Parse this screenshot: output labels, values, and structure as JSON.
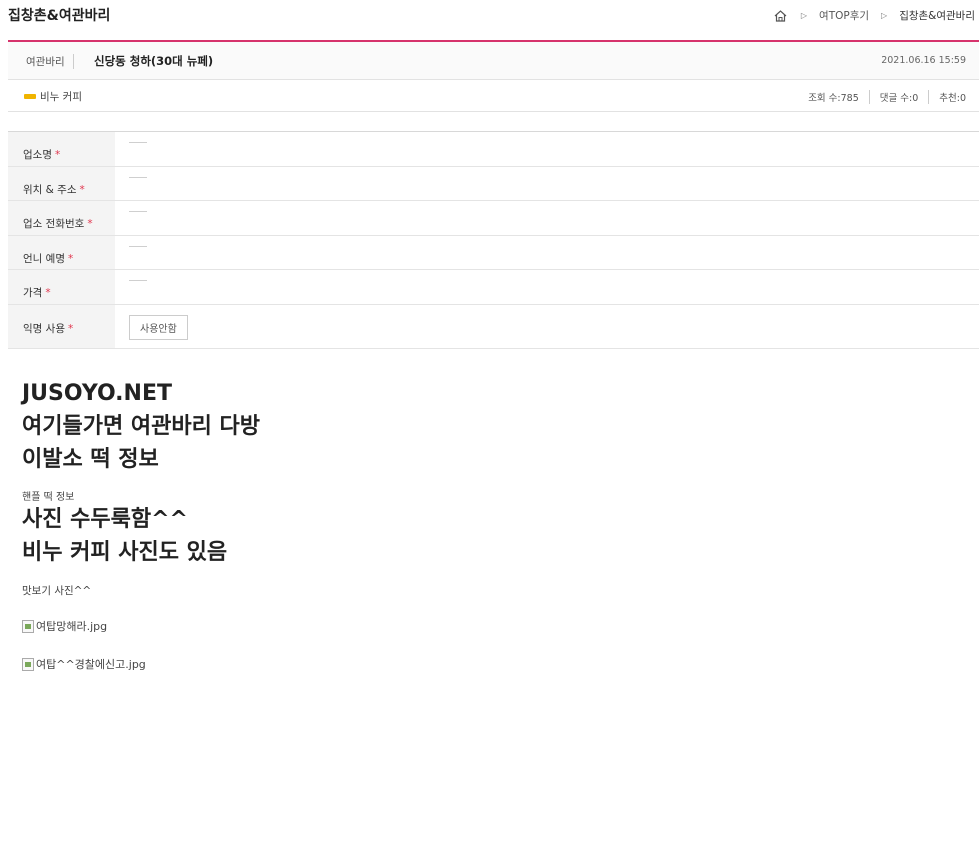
{
  "site": {
    "title": "집창촌&여관바리"
  },
  "breadcrumb": {
    "items": [
      "여TOP후기",
      "집창촌&여관바리"
    ]
  },
  "post": {
    "category": "여관바리",
    "title": "신당동 청하(30대 뉴페)",
    "date": "2021.06.16 15:59",
    "author": "비누 커피",
    "stats": [
      "조회 수:785",
      "댓글 수:0",
      "추천:0"
    ]
  },
  "info": {
    "rows": [
      {
        "label": "업소명",
        "value": ""
      },
      {
        "label": "위치 & 주소",
        "value": ""
      },
      {
        "label": "업소 전화번호",
        "value": ""
      },
      {
        "label": "언니 예명",
        "value": ""
      },
      {
        "label": "가격",
        "value": ""
      },
      {
        "label": "익명 사용",
        "value": "사용안함"
      }
    ],
    "required_mark": "*"
  },
  "content": {
    "headline_lines": [
      "JUSOYO.NET",
      "여기들가면 여관바리 다방",
      "이발소 떡 정보"
    ],
    "small_text": "핸플 떡 정보",
    "headline2_lines": [
      "사진 수두룩함^^",
      "비누 커피 사진도 있음"
    ],
    "preview_label": "맛보기 사진^^",
    "images": [
      "여탑망해라.jpg",
      "여탑^^경찰에신고.jpg"
    ]
  },
  "colors": {
    "accent": "#d6336c",
    "required": "#e0364e",
    "tag": "#f0b400"
  }
}
